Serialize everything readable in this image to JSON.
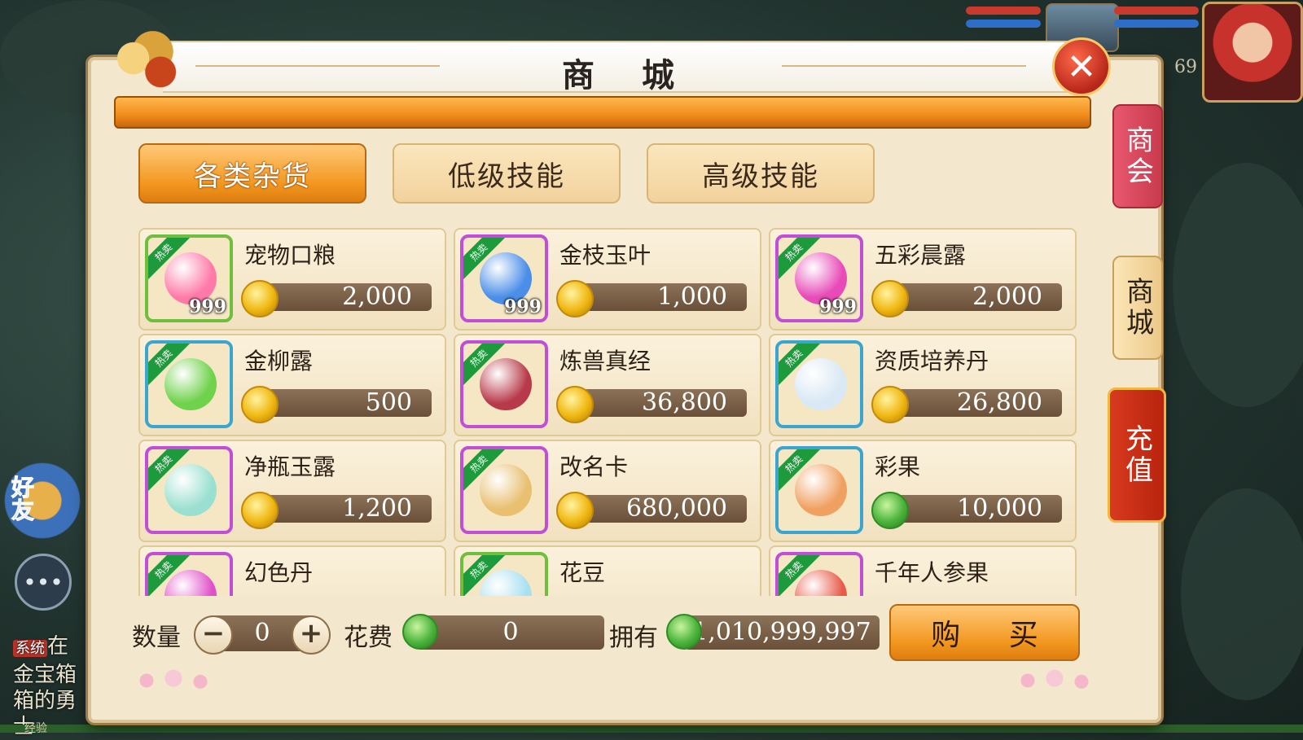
{
  "window": {
    "title": "商 城"
  },
  "hud": {
    "level": "69"
  },
  "side_left": {
    "friends_label": "好友",
    "system_tag": "系统",
    "message": "在金宝箱箱的勇士",
    "exp_label": "经验"
  },
  "tabs": [
    {
      "label": "各类杂货",
      "active": true
    },
    {
      "label": "低级技能",
      "active": false
    },
    {
      "label": "高级技能",
      "active": false
    }
  ],
  "items": [
    {
      "name": "宠物口粮",
      "price": "2,000",
      "qty": "999",
      "hot": "热卖",
      "currency": "gold-coin",
      "frame": "green"
    },
    {
      "name": "金枝玉叶",
      "price": "1,000",
      "qty": "999",
      "hot": "热卖",
      "currency": "gold-coin",
      "frame": "purple"
    },
    {
      "name": "五彩晨露",
      "price": "2,000",
      "qty": "999",
      "hot": "热卖",
      "currency": "gold-coin",
      "frame": "purple"
    },
    {
      "name": "金柳露",
      "price": "500",
      "qty": "",
      "hot": "热卖",
      "currency": "gold-coin",
      "frame": "blue"
    },
    {
      "name": "炼兽真经",
      "price": "36,800",
      "qty": "",
      "hot": "热卖",
      "currency": "gold-coin",
      "frame": "purple"
    },
    {
      "name": "资质培养丹",
      "price": "26,800",
      "qty": "",
      "hot": "热卖",
      "currency": "gold-coin",
      "frame": "blue"
    },
    {
      "name": "净瓶玉露",
      "price": "1,200",
      "qty": "",
      "hot": "热卖",
      "currency": "gold-coin",
      "frame": "purple"
    },
    {
      "name": "改名卡",
      "price": "680,000",
      "qty": "",
      "hot": "热卖",
      "currency": "gold-coin",
      "frame": "purple"
    },
    {
      "name": "彩果",
      "price": "10,000",
      "qty": "",
      "hot": "热卖",
      "currency": "jade-coin",
      "frame": "blue"
    },
    {
      "name": "幻色丹",
      "price": "",
      "qty": "",
      "hot": "热卖",
      "currency": "gold-coin",
      "frame": "purple"
    },
    {
      "name": "花豆",
      "price": "",
      "qty": "",
      "hot": "热卖",
      "currency": "gold-coin",
      "frame": "green"
    },
    {
      "name": "千年人参果",
      "price": "",
      "qty": "",
      "hot": "热卖",
      "currency": "gold-coin",
      "frame": "purple"
    }
  ],
  "footer": {
    "quantity_label": "数量",
    "quantity_value": "0",
    "minus": "−",
    "plus": "+",
    "cost_label": "花费",
    "cost_value": "0",
    "own_label": "拥有",
    "own_value": "1,010,999,997",
    "buy_label": "购 买"
  },
  "side_tabs": {
    "guild": "商会",
    "mall": "商城",
    "recharge": "充值"
  },
  "icons": {
    "close": "close-x-icon",
    "coin_gold": "gold-coin-icon",
    "coin_jade": "jade-coin-icon"
  },
  "colors": {
    "panel_bg": "#f3e8cd",
    "accent_orange": "#f2961e",
    "price_bar": "#6a5038",
    "hot_badge": "#1d9a3b"
  }
}
